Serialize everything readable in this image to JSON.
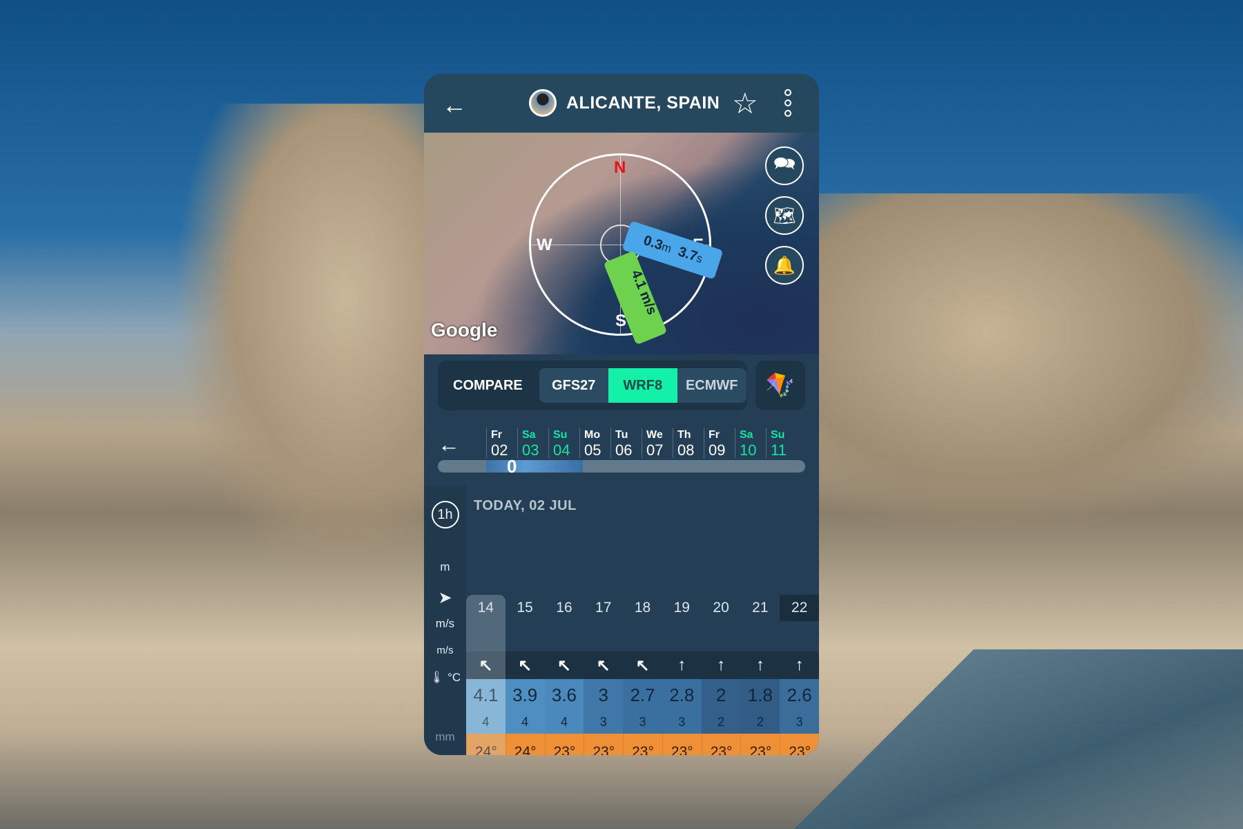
{
  "header": {
    "title": "ALICANTE, SPAIN",
    "back_icon": "arrow-left-icon",
    "favorite_icon": "star-outline-icon",
    "menu_icon": "more-vertical-icon"
  },
  "map": {
    "compass": {
      "n": "N",
      "e": "E",
      "s": "S",
      "w": "W"
    },
    "swell_height": "0.3",
    "swell_height_unit": "m",
    "swell_period": "3.7",
    "swell_period_unit": "s",
    "wind_speed": "4.1 m/s",
    "attribution": "Google",
    "buttons": [
      "chat-icon",
      "map-pin-icon",
      "bell-icon"
    ],
    "colors": {
      "north": "#e8101a",
      "swell": "#4aa6e8",
      "wind": "#6fd24e"
    }
  },
  "compare": {
    "label": "COMPARE",
    "models": [
      {
        "label": "GFS27",
        "active": false
      },
      {
        "label": "WRF8",
        "active": true
      },
      {
        "label": "ECMWF",
        "active": false
      }
    ],
    "accent": "#13f0a8",
    "sport_icon": "kitesurf-icon"
  },
  "days": [
    {
      "n": "Fr",
      "d": "02"
    },
    {
      "n": "Sa",
      "d": "03",
      "we": true
    },
    {
      "n": "Su",
      "d": "04",
      "we": true
    },
    {
      "n": "Mo",
      "d": "05"
    },
    {
      "n": "Tu",
      "d": "06"
    },
    {
      "n": "We",
      "d": "07"
    },
    {
      "n": "Th",
      "d": "08"
    },
    {
      "n": "Fr",
      "d": "09"
    },
    {
      "n": "Sa",
      "d": "10",
      "we": true
    },
    {
      "n": "Su",
      "d": "11",
      "we": true
    }
  ],
  "slider": {
    "thumb": "0"
  },
  "table": {
    "interval": "1h",
    "date": "TODAY, 02 JUL",
    "labels": {
      "wave": "m",
      "dir_icon": "navigation-icon",
      "wind": "m/s",
      "gust": "m/s",
      "temp": "°C",
      "temp_icon": "thermometer-icon",
      "rain": "mm"
    },
    "hours": [
      "14",
      "15",
      "16",
      "17",
      "18",
      "19",
      "20",
      "21",
      "22"
    ],
    "directions": [
      "↖",
      "↖",
      "↖",
      "↖",
      "↖",
      "↑",
      "↑",
      "↑",
      "↑"
    ],
    "wind": [
      "4.1",
      "3.9",
      "3.6",
      "3",
      "2.7",
      "2.8",
      "2",
      "1.8",
      "2.6"
    ],
    "gust": [
      "4",
      "4",
      "4",
      "3",
      "3",
      "3",
      "2",
      "2",
      "3"
    ],
    "temp": [
      "24°",
      "24°",
      "23°",
      "23°",
      "23°",
      "23°",
      "23°",
      "23°",
      "23°"
    ]
  }
}
